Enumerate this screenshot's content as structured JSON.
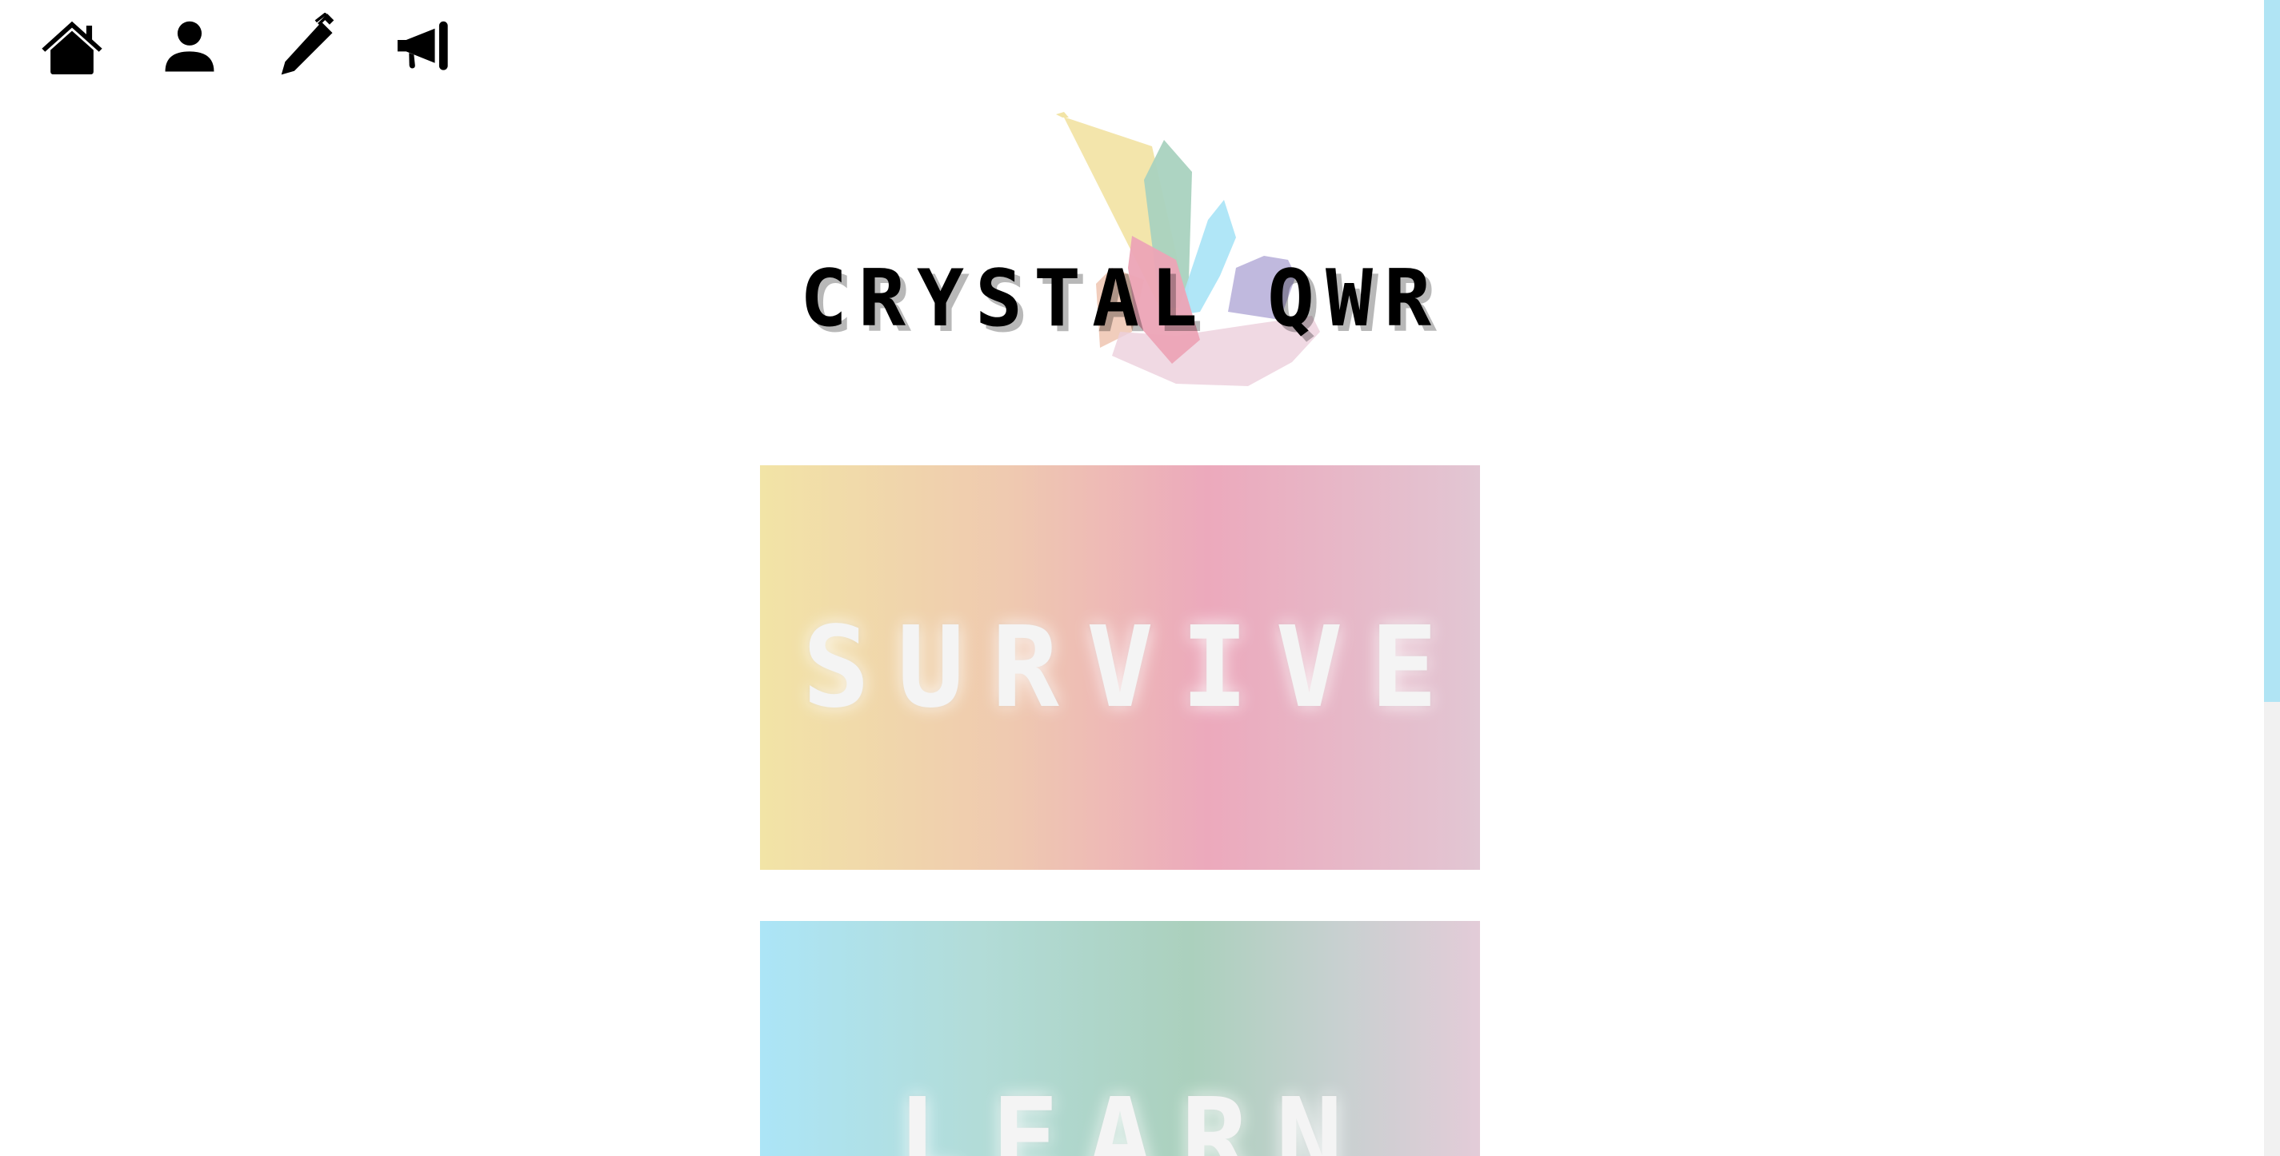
{
  "nav": {
    "items": [
      {
        "icon": "home-icon",
        "name": "home"
      },
      {
        "icon": "user-icon",
        "name": "profile"
      },
      {
        "icon": "pen-icon",
        "name": "write"
      },
      {
        "icon": "megaphone-icon",
        "name": "announcements"
      }
    ]
  },
  "logo": {
    "title": "CRYSTAL QWR"
  },
  "buttons": {
    "survive": "SURVIVE",
    "learn": "LEARN"
  },
  "colors": {
    "survive_gradient": [
      "#f2e4a6",
      "#efc9b0",
      "#eca9bc",
      "#e2c6d3"
    ],
    "learn_gradient": [
      "#ace5f7",
      "#b2dcd8",
      "#abd0bd",
      "#e3ccd8"
    ],
    "scroll_thumb": "#b0e4f4"
  }
}
